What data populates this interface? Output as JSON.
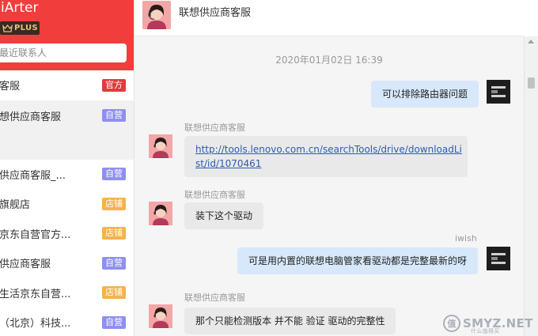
{
  "sidebar": {
    "username": "iArter",
    "badge_label": "PLUS",
    "search_placeholder": "最近联系人",
    "contacts": [
      {
        "name": "客服",
        "tag": "官方"
      },
      {
        "name": "想供应商客服",
        "tag": "自营"
      },
      {
        "name": "供应商客服_...",
        "tag": "自营"
      },
      {
        "name": "旗舰店",
        "tag": "店铺"
      },
      {
        "name": "京东自营官方...",
        "tag": "店铺"
      },
      {
        "name": "供应商客服",
        "tag": "自营"
      },
      {
        "name": "生活京东自营...",
        "tag": "店铺"
      },
      {
        "name": "（北京）科技...",
        "tag": "自营"
      }
    ]
  },
  "chat": {
    "title": "联想供应商客服",
    "timestamp": "2020年01月02日 16:39",
    "messages": [
      {
        "sender": "",
        "text": "可以排除路由器问题"
      },
      {
        "sender": "联想供应商客服",
        "link_line1": "http://tools.lenovo.com.cn/searchTools/drive/downloadLi",
        "link_line2": "st/id/1070461"
      },
      {
        "sender": "联想供应商客服",
        "text": "装下这个驱动"
      },
      {
        "sender": "iwish",
        "text": "可是用内置的联想电脑管家看驱动都是完整最新的呀"
      },
      {
        "sender": "联想供应商客服",
        "text": "那个只能检测版本 并不能 验证 驱动的完整性"
      }
    ]
  },
  "watermark": {
    "main": "SMYZ.NET",
    "sub": "什么值得买"
  },
  "colors": {
    "brand_red": "#f23d3d",
    "tag_red": "#e23b3b",
    "tag_purple": "#8f8ff0",
    "tag_orange": "#f5b24d",
    "outgoing_bubble": "#d7e8fb",
    "incoming_bubble": "#e9e9e9"
  }
}
